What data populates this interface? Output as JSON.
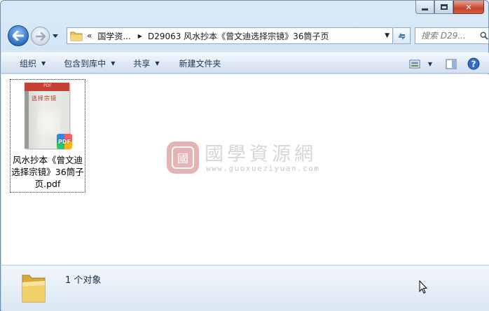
{
  "window": {
    "caption_minimize": "minimize",
    "caption_maximize": "maximize",
    "caption_close": "✕"
  },
  "address": {
    "chevron": "«",
    "segments": [
      "国学资...",
      "D29063 风水抄本《曾文迪选择宗镜》36筒子页"
    ]
  },
  "search": {
    "placeholder": "搜索 D29..."
  },
  "toolbar": {
    "organize": "组织",
    "include_in_library": "包含到库中",
    "share": "共享",
    "new_folder": "新建文件夹"
  },
  "files": [
    {
      "name": "风水抄本《曾文迪选择宗镜》36筒子页.pdf",
      "badge": "PDF",
      "thumb_band": "PDF",
      "thumb_title": "选择宗镜"
    }
  ],
  "watermark": {
    "seal": "國",
    "title": "國學資源網",
    "url": "www.guoxueziyuan.com"
  },
  "details": {
    "count_text": "1 个对象"
  },
  "colors": {
    "accent": "#2b6fc2",
    "close": "#c6452e",
    "frame": "#c7dcf0"
  }
}
